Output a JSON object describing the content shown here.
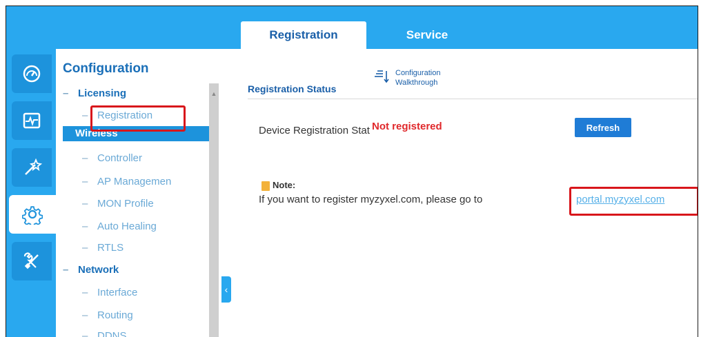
{
  "tabs": [
    {
      "label": "Registration",
      "active": true
    },
    {
      "label": "Service",
      "active": false
    }
  ],
  "rail": [
    {
      "icon": "dashboard-icon"
    },
    {
      "icon": "monitor-icon"
    },
    {
      "icon": "wizard-icon"
    },
    {
      "icon": "configuration-gear-icon",
      "active": true
    },
    {
      "icon": "maintenance-tools-icon"
    }
  ],
  "nav": {
    "title": "Configuration",
    "items": [
      {
        "label": "Licensing",
        "type": "group"
      },
      {
        "label": "Registration",
        "type": "sub",
        "highlighted": true
      },
      {
        "label": "Wireless",
        "type": "selected"
      },
      {
        "label": "Controller",
        "type": "sub"
      },
      {
        "label": "AP Managemen",
        "type": "sub"
      },
      {
        "label": "MON Profile",
        "type": "sub"
      },
      {
        "label": "Auto Healing",
        "type": "sub"
      },
      {
        "label": "RTLS",
        "type": "sub"
      },
      {
        "label": "Network",
        "type": "group"
      },
      {
        "label": "Interface",
        "type": "sub"
      },
      {
        "label": "Routing",
        "type": "sub"
      },
      {
        "label": "DDNS",
        "type": "sub"
      }
    ]
  },
  "content": {
    "section_title": "Registration Status",
    "walkthrough": {
      "line1": "Configuration",
      "line2": "Walkthrough"
    },
    "status_label": "Device Registration Stat",
    "status_value": "Not registered",
    "refresh_label": "Refresh",
    "note_label": "Note:",
    "note_text": "If you want to register myzyxel.com, please go to",
    "note_link": "portal.myzyxel.com",
    "note_end": "."
  },
  "colors": {
    "accent": "#29a8ef",
    "accent_dark": "#1d93dc",
    "title_blue": "#1a5fa8",
    "status_red": "#e0282b",
    "highlight_red": "#d8161b",
    "link": "#56b0e8"
  }
}
